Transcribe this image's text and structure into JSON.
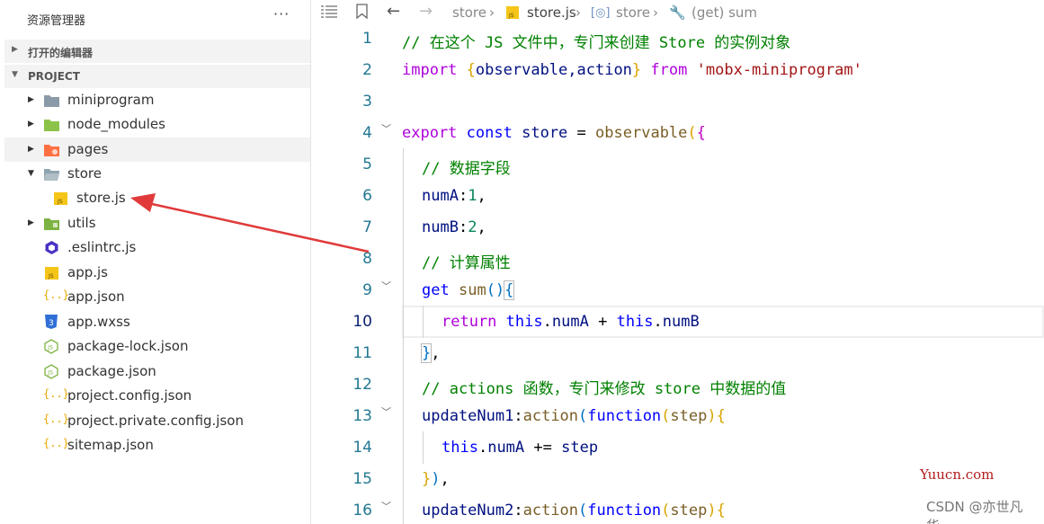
{
  "sidebar": {
    "title": "资源管理器",
    "more": "···",
    "open_editors": "打开的编辑器",
    "project": "PROJECT",
    "items": [
      {
        "label": "miniprogram"
      },
      {
        "label": "node_modules"
      },
      {
        "label": "pages"
      },
      {
        "label": "store"
      },
      {
        "label": "store.js"
      },
      {
        "label": "utils"
      },
      {
        "label": ".eslintrc.js"
      },
      {
        "label": "app.js"
      },
      {
        "label": "app.json"
      },
      {
        "label": "app.wxss"
      },
      {
        "label": "package-lock.json"
      },
      {
        "label": "package.json"
      },
      {
        "label": "project.config.json"
      },
      {
        "label": "project.private.config.json"
      },
      {
        "label": "sitemap.json"
      }
    ]
  },
  "breadcrumb": {
    "part1": "store",
    "part2": "store.js",
    "part3": "store",
    "part4": "(get) sum"
  },
  "editor": {
    "line_numbers": [
      "1",
      "2",
      "3",
      "4",
      "5",
      "6",
      "7",
      "8",
      "9",
      "10",
      "11",
      "12",
      "13",
      "14",
      "15",
      "16"
    ],
    "active_line": "10",
    "lines": {
      "l1": "// 在这个 JS 文件中，专门来创建 Store 的实例对象",
      "l2_kw": "import",
      "l2_b1": "{",
      "l2_names": "observable,action",
      "l2_b2": "}",
      "l2_from": "from",
      "l2_str": "'mobx-miniprogram'",
      "l4_export": "export",
      "l4_const": "const",
      "l4_store": "store",
      "l4_eq": "=",
      "l4_fn": "observable",
      "l4_p": "(",
      "l4_b": "{",
      "l5": "// 数据字段",
      "l6_k": "numA",
      "l6_v": "1",
      "l7_k": "numB",
      "l7_v": "2",
      "l8": "// 计算属性",
      "l9_get": "get",
      "l9_sum": "sum",
      "l9_p": "()",
      "l9_b": "{",
      "l10_return": "return",
      "l10_this1": "this",
      "l10_a": "numA",
      "l10_plus": "+",
      "l10_this2": "this",
      "l10_b": "numB",
      "l11_b": "}",
      "l12_c1": "// actions 函数，专门来修改 store 中数据的值",
      "l13_k": "updateNum1",
      "l13_action": "action",
      "l13_function": "function",
      "l13_param": "step",
      "l14_this": "this",
      "l14_a": "numA",
      "l14_op": "+=",
      "l14_step": "step",
      "l15_b": "}",
      "l15_p": ")",
      "l16_k": "updateNum2",
      "l16_action": "action",
      "l16_function": "function",
      "l16_param": "step"
    }
  },
  "watermark": {
    "site": "Yuucn.com",
    "author": "CSDN @亦世凡华、"
  },
  "colors": {
    "comment": "#008000",
    "keyword": "#0000ff",
    "string": "#a31515",
    "number": "#098658",
    "arrow": "#e03a3a"
  }
}
